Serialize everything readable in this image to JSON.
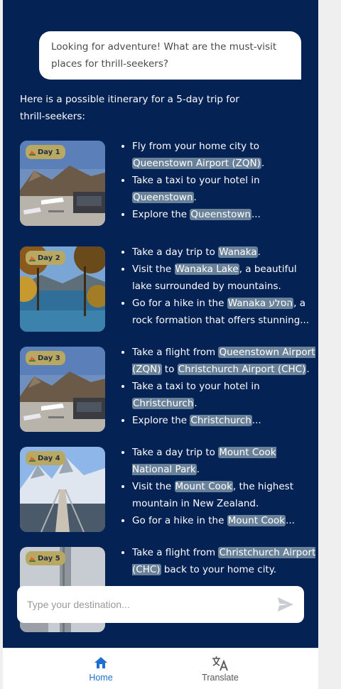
{
  "chat": {
    "user_message": "Looking for adventure! What are the must-visit places for thrill-seekers?",
    "intro": "Here is a possible itinerary for a 5-day trip for thrill-seekers:"
  },
  "days": [
    {
      "label": "Day 1",
      "image": "airport-mountains",
      "items": [
        [
          {
            "t": "Fly from your home city to "
          },
          {
            "t": "Queenstown Airport (ZQN)",
            "h": true
          },
          {
            "t": "."
          }
        ],
        [
          {
            "t": "Take a taxi to your hotel in "
          },
          {
            "t": "Queenstown",
            "h": true
          },
          {
            "t": "."
          }
        ],
        [
          {
            "t": "Explore the "
          },
          {
            "t": "Queenstown",
            "h": true
          },
          {
            "t": "..."
          }
        ]
      ]
    },
    {
      "label": "Day 2",
      "image": "lake-autumn",
      "items": [
        [
          {
            "t": "Take a day trip to "
          },
          {
            "t": "Wanaka",
            "h": true
          },
          {
            "t": "."
          }
        ],
        [
          {
            "t": "Visit the "
          },
          {
            "t": "Wanaka Lake",
            "h": true
          },
          {
            "t": ", a beautiful lake surrounded by mountains."
          }
        ],
        [
          {
            "t": "Go for a hike in the "
          },
          {
            "t": "Wanaka הסלע",
            "h": true
          },
          {
            "t": ", a rock formation that offers stunning..."
          }
        ]
      ]
    },
    {
      "label": "Day 3",
      "image": "airport-mountains",
      "items": [
        [
          {
            "t": "Take a flight from "
          },
          {
            "t": "Queenstown Airport (ZQN)",
            "h": true
          },
          {
            "t": " to "
          },
          {
            "t": "Christchurch Airport (CHC)",
            "h": true
          },
          {
            "t": "."
          }
        ],
        [
          {
            "t": "Take a taxi to your hotel in "
          },
          {
            "t": "Christchurch",
            "h": true
          },
          {
            "t": "."
          }
        ],
        [
          {
            "t": "Explore the "
          },
          {
            "t": "Christchurch",
            "h": true
          },
          {
            "t": "..."
          }
        ]
      ]
    },
    {
      "label": "Day 4",
      "image": "suspension-bridge",
      "items": [
        [
          {
            "t": "Take a day trip to "
          },
          {
            "t": "Mount Cook National Park",
            "h": true
          },
          {
            "t": "."
          }
        ],
        [
          {
            "t": "Visit the "
          },
          {
            "t": "Mount Cook",
            "h": true
          },
          {
            "t": ", the highest mountain in New Zealand."
          }
        ],
        [
          {
            "t": "Go for a hike in the "
          },
          {
            "t": "Mount Cook",
            "h": true
          },
          {
            "t": "..."
          }
        ]
      ]
    },
    {
      "label": "Day 5",
      "image": "city-tower",
      "items": [
        [
          {
            "t": "Take a flight from "
          },
          {
            "t": "Christchurch Airport (CHC)",
            "h": true
          },
          {
            "t": " back to your home city."
          }
        ]
      ]
    }
  ],
  "input": {
    "placeholder": "Type your destination..."
  },
  "nav": {
    "home_label": "Home",
    "translate_label": "Translate"
  },
  "icons": {
    "badge": "mountain-icon",
    "send": "send-icon",
    "home": "home-icon",
    "translate": "translate-icon"
  },
  "colors": {
    "chat_bg": "#052255",
    "highlight": "#6a8299",
    "badge": "#b9a862",
    "accent": "#1f6fd1"
  }
}
